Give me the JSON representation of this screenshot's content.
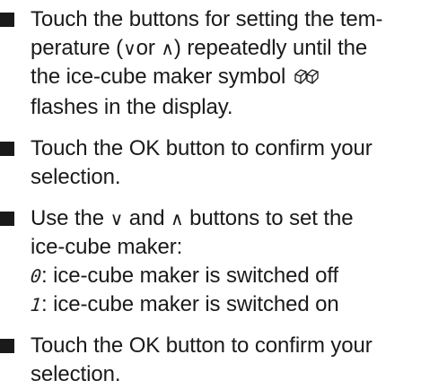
{
  "steps": [
    {
      "lines": [
        [
          "Touch the buttons for setting the tem-"
        ],
        [
          "perature (",
          "∨",
          "or ",
          "∧",
          ") repeatedly until the"
        ],
        [
          "the ice-cube maker symbol "
        ],
        [
          "flashes in the display."
        ]
      ]
    },
    {
      "lines": [
        [
          "Touch the OK button to confirm your"
        ],
        [
          "selection."
        ]
      ]
    },
    {
      "lines": [
        [
          "Use the ",
          "∨",
          " and ",
          "∧",
          " buttons to set the"
        ],
        [
          "ice-cube maker:"
        ],
        [
          "0",
          ": ice-cube maker is switched off"
        ],
        [
          "1",
          ": ice-cube maker is switched on"
        ]
      ]
    },
    {
      "lines": [
        [
          "Touch the OK button to confirm your"
        ],
        [
          "selection."
        ]
      ]
    }
  ],
  "icons": {
    "ice_cube_maker": "ice-cube-maker-icon",
    "bullet": "square-bullet"
  },
  "colors": {
    "text": "#1a1a1a",
    "bullet": "#1a1a1a"
  }
}
